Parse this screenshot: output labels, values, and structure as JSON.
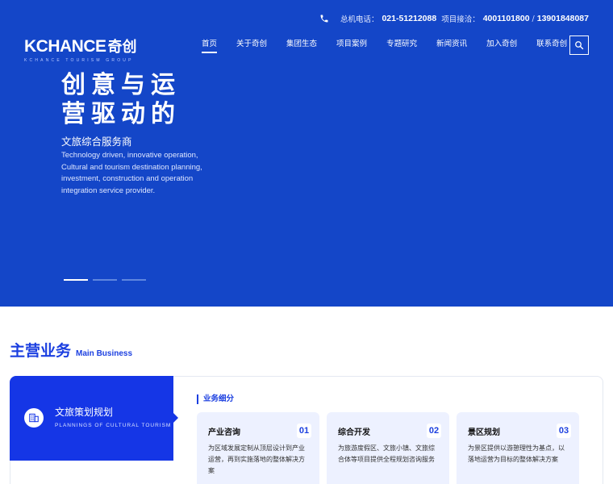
{
  "topbar": {
    "hotline_label": "总机电话：",
    "hotline": "021-51212088",
    "project_label": "项目接洽：",
    "project_phone_1": "4001101800",
    "separator": "/",
    "project_phone_2": "13901848087"
  },
  "logo": {
    "text": "KCHANCE",
    "cn": "奇创",
    "sub": "KCHANCE TOURISM GROUP"
  },
  "nav": {
    "items": [
      {
        "label": "首页",
        "active": true
      },
      {
        "label": "关于奇创"
      },
      {
        "label": "集团生态"
      },
      {
        "label": "项目案例"
      },
      {
        "label": "专题研究"
      },
      {
        "label": "新闻资讯"
      },
      {
        "label": "加入奇创"
      },
      {
        "label": "联系奇创"
      }
    ]
  },
  "hero": {
    "title_line1": "创意与运",
    "title_line2": "营驱动的",
    "subtitle": "文旅综合服务商",
    "desc_line1": "Technology driven, innovative operation,",
    "desc_line2": "Cultural and tourism destination planning,",
    "desc_line3": "investment, construction and operation",
    "desc_line4": "integration service provider.",
    "slides": 3,
    "active_slide": 1
  },
  "business": {
    "title_cn": "主营业务",
    "title_en": "Main Business",
    "category": {
      "title": "文旅策划规划",
      "sub": "PLANNINGS OF CULTURAL TOURISM",
      "icon": "building-plan-icon"
    },
    "sub_heading": "业务细分",
    "cards": [
      {
        "title": "产业咨询",
        "num": "01",
        "desc": "为区域发展定制从顶层设计到产业运营，再到实施落地的整体解决方案"
      },
      {
        "title": "综合开发",
        "num": "02",
        "desc": "为旅游度假区、文旅小镇、文旅综合体等项目提供全程规划咨询服务"
      },
      {
        "title": "景区规划",
        "num": "03",
        "desc": "为景区提供以游憩理性为基点，以落地运营为目标的整体解决方案"
      }
    ]
  },
  "colors": {
    "hero_bg": "#1446c8",
    "accent": "#1b3fe0",
    "category_bg": "#1536e6",
    "card_bg": "#edf1ff"
  }
}
